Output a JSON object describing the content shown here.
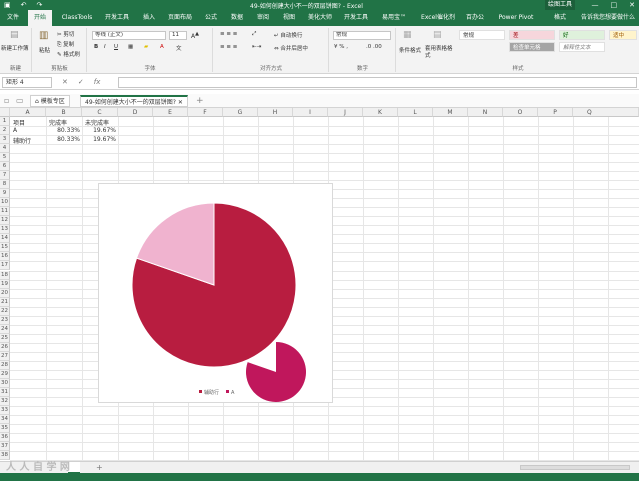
{
  "window": {
    "title": "49-如何创建大小不一的双层饼图? - Excel",
    "context_tab": "绘图工具",
    "controls": [
      "—",
      "□",
      "✕"
    ]
  },
  "qat": [
    "save-icon",
    "undo-icon",
    "redo-icon"
  ],
  "tabs": [
    "文件",
    "开始",
    "ClassTools",
    "开发工具",
    "插入",
    "页面布局",
    "公式",
    "数据",
    "审阅",
    "视图",
    "美化大师",
    "开发工具",
    "易用宝™",
    "Excel催化剂",
    "百办公",
    "Power Pivot",
    "格式"
  ],
  "tell_me": "告诉我您想要做什么",
  "ribbon": {
    "clipboard": {
      "label": "剪贴板",
      "paste": "粘贴",
      "cut": "剪切",
      "copy": "复制",
      "painter": "格式刷"
    },
    "font": {
      "label": "字体",
      "name": "等线 (正文)",
      "size": "11",
      "bold": "B",
      "italic": "I",
      "underline": "U"
    },
    "alignment": {
      "label": "对齐方式",
      "wrap": "自动换行",
      "merge": "合并后居中"
    },
    "number": {
      "label": "数字",
      "format": "常规"
    },
    "styles": {
      "label": "样式",
      "cond_format": "条件格式",
      "table_format": "套用表格格式",
      "cells": [
        "常规",
        "差",
        "好",
        "适中",
        "检查单元格",
        "解释性文本"
      ]
    },
    "first_group": {
      "label": "新建",
      "btn": "新建工作簿"
    }
  },
  "formula_bar": {
    "name_box": "矩形 4",
    "cancel": "✕",
    "enter": "✓",
    "fx": "fx",
    "content": ""
  },
  "doc_tabs": {
    "tab1": "模板专区",
    "tab2": "49-如何创建大小不一的双层饼图?",
    "add": "+"
  },
  "columns": [
    "A",
    "B",
    "C",
    "D",
    "E",
    "F",
    "G",
    "H",
    "I",
    "J",
    "K",
    "L",
    "M",
    "N",
    "O",
    "P",
    "Q"
  ],
  "rows": [
    "1",
    "2",
    "3",
    "4",
    "5",
    "6",
    "7",
    "8",
    "9",
    "10",
    "11",
    "12",
    "13",
    "14",
    "15",
    "16",
    "17",
    "18",
    "19",
    "20",
    "21",
    "22",
    "23",
    "24",
    "25",
    "26",
    "27",
    "28",
    "29",
    "30",
    "31",
    "32",
    "33",
    "34",
    "35",
    "36",
    "37",
    "38"
  ],
  "cells": {
    "a1": "项目",
    "b1": "完成率",
    "c1": "未完成率",
    "a2": "A",
    "b2": "80.33%",
    "c2": "19.67%",
    "a3": "辅助行",
    "b3": "80.33%",
    "c3": "19.67%"
  },
  "chart_data": {
    "type": "pie",
    "series": [
      {
        "name": "辅助行",
        "categories": [
          "完成率",
          "未完成率"
        ],
        "values": [
          80.33,
          19.67
        ],
        "colors": [
          "#b81d40",
          "#f0b3cf"
        ]
      },
      {
        "name": "A",
        "categories": [
          "完成率",
          "未完成率"
        ],
        "values": [
          80.33,
          19.67
        ],
        "colors": [
          "#c0175c",
          "#f8d5e4"
        ]
      }
    ],
    "legend": {
      "position": "bottom",
      "entries": [
        "辅助行",
        "A"
      ],
      "colors": [
        "#b81d40",
        "#c0175c"
      ]
    }
  },
  "sheet": {
    "add": "+"
  },
  "watermark": "人 人 自 学 网"
}
